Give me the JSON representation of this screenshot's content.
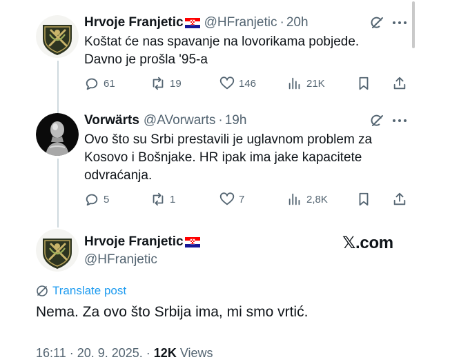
{
  "tweet1": {
    "name": "Hrvoje Franjetic",
    "handle": "@HFranjetic",
    "time": "20h",
    "text_line1": "Koštat će nas spavanje na lovorikama pobjede.",
    "text_line2": "Davno je prošla '95-a",
    "replies": "61",
    "reposts": "19",
    "likes": "146",
    "views": "21K"
  },
  "tweet2": {
    "name": "Vorwärts",
    "handle": "@AVorwarts",
    "time": "19h",
    "text_line1": "Ovo što su Srbi prestavili je uglavnom problem za",
    "text_line2": "Kosovo i Bošnjake. HR ipak ima jake kapacitete",
    "text_line3": "odvraćanja.",
    "replies": "5",
    "reposts": "1",
    "likes": "7",
    "views": "2,8K"
  },
  "main": {
    "name": "Hrvoje Franjetic",
    "handle": "@HFranjetic",
    "translate": "Translate post",
    "text": "Nema. Za ovo što Srbija ima, mi smo vrtić.",
    "timestamp": "16:11 · 20. 9. 2025. ·",
    "views_count": "12K",
    "views_label": "Views"
  },
  "watermark": "𝕏.com",
  "icons": {
    "reply": "reply-icon",
    "repost": "repost-icon",
    "like": "like-icon",
    "views": "views-icon",
    "bookmark": "bookmark-icon",
    "share": "share-icon",
    "grok": "grok-icon",
    "more": "more-icon",
    "translate": "globe-icon",
    "flag": "croatia-flag-icon"
  },
  "colors": {
    "text": "#0f1419",
    "secondary": "#536471",
    "accent": "#1d9bf0",
    "thread_line": "#cfd9de"
  }
}
